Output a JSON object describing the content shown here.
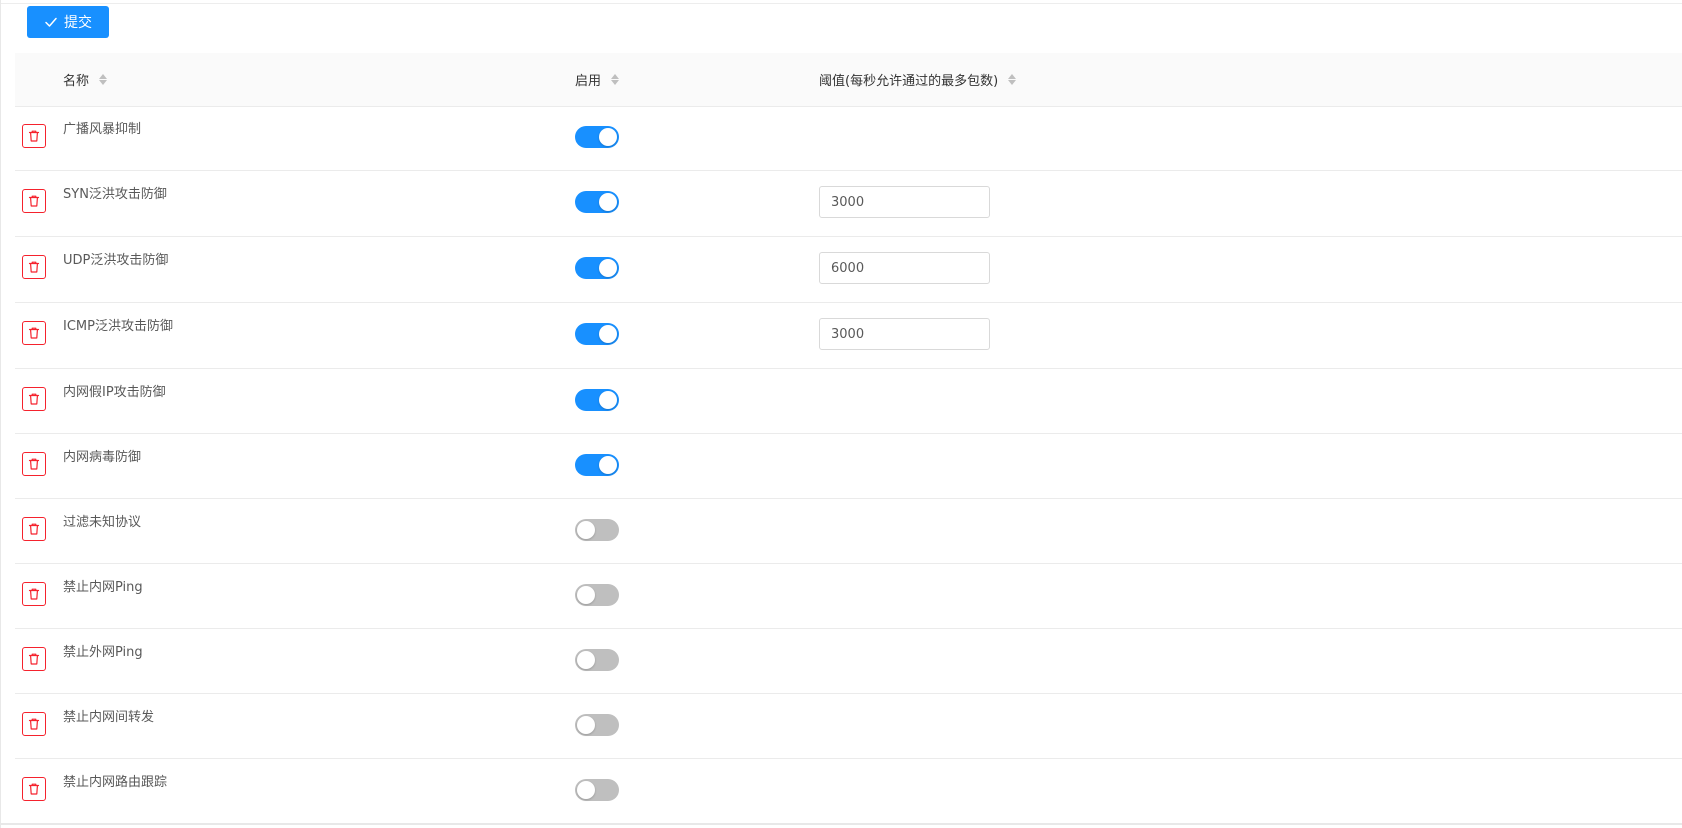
{
  "toolbar": {
    "submit_label": "提交"
  },
  "table": {
    "columns": {
      "name": "名称",
      "enabled": "启用",
      "threshold": "阈值(每秒允许通过的最多包数)"
    },
    "rows": [
      {
        "name": "广播风暴抑制",
        "enabled": true,
        "threshold": null
      },
      {
        "name": "SYN泛洪攻击防御",
        "enabled": true,
        "threshold": "3000"
      },
      {
        "name": "UDP泛洪攻击防御",
        "enabled": true,
        "threshold": "6000"
      },
      {
        "name": "ICMP泛洪攻击防御",
        "enabled": true,
        "threshold": "3000"
      },
      {
        "name": "内网假IP攻击防御",
        "enabled": true,
        "threshold": null
      },
      {
        "name": "内网病毒防御",
        "enabled": true,
        "threshold": null
      },
      {
        "name": "过滤未知协议",
        "enabled": false,
        "threshold": null
      },
      {
        "name": "禁止内网Ping",
        "enabled": false,
        "threshold": null
      },
      {
        "name": "禁止外网Ping",
        "enabled": false,
        "threshold": null
      },
      {
        "name": "禁止内网间转发",
        "enabled": false,
        "threshold": null
      },
      {
        "name": "禁止内网路由跟踪",
        "enabled": false,
        "threshold": null
      }
    ]
  },
  "colors": {
    "accent": "#1890ff",
    "danger": "#f5222d",
    "switch_off": "#bfbfbf"
  },
  "icons": {
    "submit": "check-icon",
    "delete": "trash-icon",
    "sort": "sort-icon"
  }
}
